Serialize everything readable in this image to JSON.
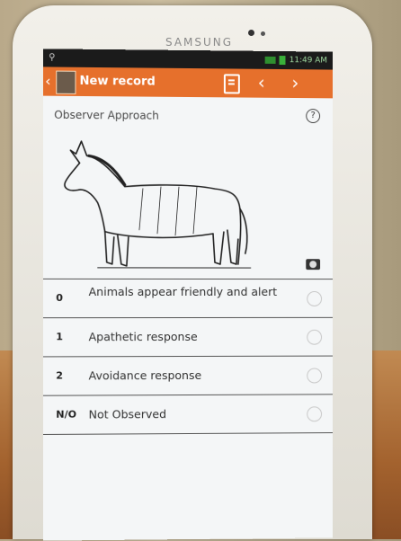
{
  "device": {
    "brand": "SAMSUNG"
  },
  "status_bar": {
    "time": "11:49 AM"
  },
  "action_bar": {
    "title": "New record"
  },
  "question": {
    "title": "Observer Approach",
    "help_label": "?"
  },
  "options": [
    {
      "score": "0",
      "label": "Animals appear friendly and alert"
    },
    {
      "score": "1",
      "label": "Apathetic response"
    },
    {
      "score": "2",
      "label": "Avoidance response"
    },
    {
      "score": "N/O",
      "label": "Not Observed"
    }
  ],
  "colors": {
    "action_bar": "#e6702c"
  },
  "icons": [
    "back-icon",
    "app-icon",
    "document-icon",
    "chevron-left-icon",
    "chevron-right-icon",
    "help-icon",
    "camera-icon",
    "radio-icon"
  ]
}
